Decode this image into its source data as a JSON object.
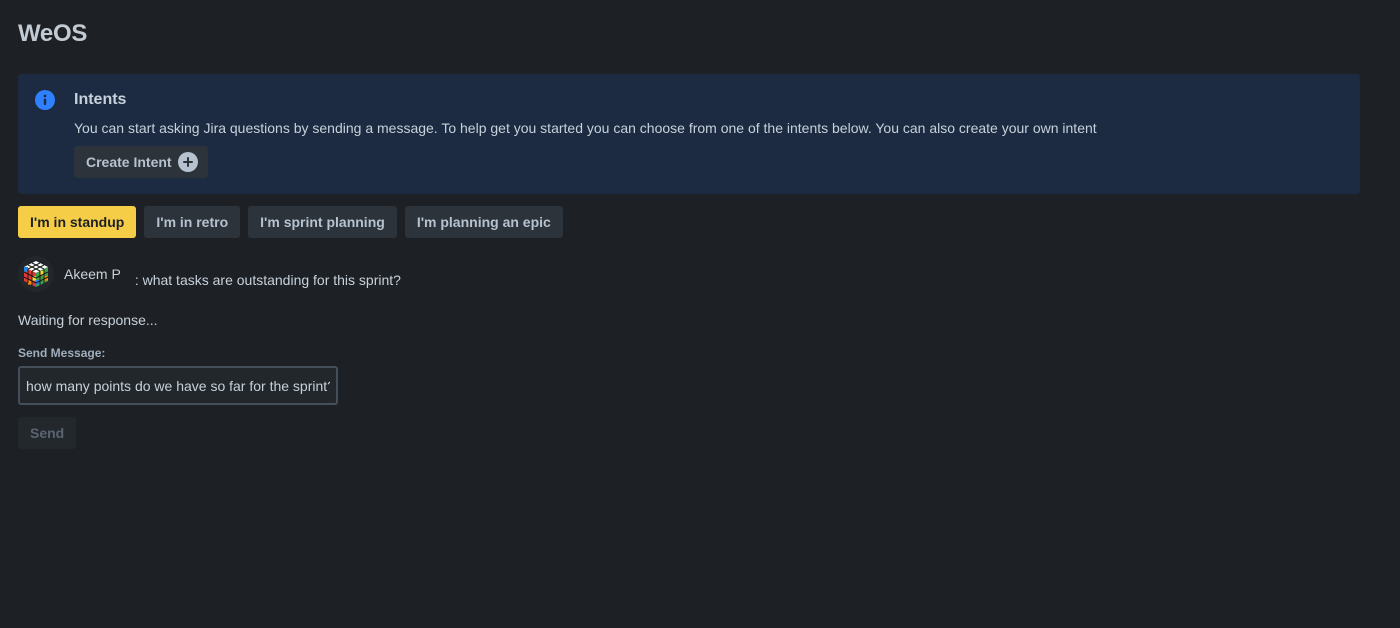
{
  "app": {
    "title": "WeOS"
  },
  "intents_panel": {
    "icon": "info-icon",
    "heading": "Intents",
    "description": "You can start asking Jira questions by sending a message. To help get you started you can choose from one of the intents below. You can also create your own intent",
    "create_button_label": "Create Intent",
    "create_button_icon": "plus-circle-icon"
  },
  "intents": [
    {
      "label": "I'm in standup",
      "selected": true
    },
    {
      "label": "I'm in retro",
      "selected": false
    },
    {
      "label": "I'm sprint planning",
      "selected": false
    },
    {
      "label": "I'm planning an epic",
      "selected": false
    }
  ],
  "conversation": {
    "messages": [
      {
        "sender": "Akeem P",
        "avatar_icon": "rubiks-cube-avatar",
        "text": ": what tasks are outstanding for this sprint?"
      }
    ],
    "status": "Waiting for response..."
  },
  "composer": {
    "label": "Send Message:",
    "value": "how many points do we have so far for the sprint?",
    "send_label": "Send",
    "send_disabled": true
  },
  "colors": {
    "background": "#1d2024",
    "panel": "#1c2b41",
    "info_blue": "#2f80ff",
    "selected_intent": "#f5cd47",
    "button": "#2c333a"
  }
}
